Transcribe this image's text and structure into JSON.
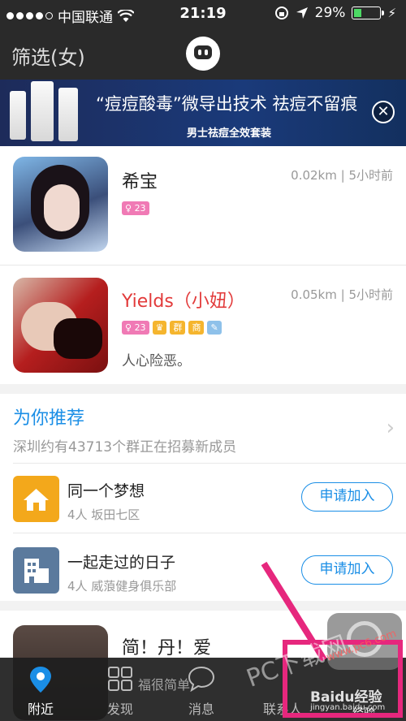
{
  "status_bar": {
    "carrier": "中国联通",
    "time": "21:19",
    "battery": "29%"
  },
  "nav": {
    "title": "筛选(女)"
  },
  "ad": {
    "headline": "“痘痘酸毒”微导出技术 祛痘不留痕",
    "sub": "男士祛痘全效套装"
  },
  "users": [
    {
      "name": "希宝",
      "distance": "0.02km",
      "time": "5小时前",
      "age": "23",
      "bio": ""
    },
    {
      "name": "Yields（小妞）",
      "distance": "0.05km",
      "time": "5小时前",
      "age": "23",
      "bio": "人心险恶。"
    },
    {
      "name": "简！丹！爱",
      "distance": "",
      "time": "",
      "age": "",
      "bio": "福很简单"
    }
  ],
  "badges": {
    "crown": "♛",
    "group": "群",
    "biz": "商"
  },
  "recommend": {
    "title": "为你推荐",
    "subtitle": "深圳约有43713个群正在招募新成员"
  },
  "groups": [
    {
      "name": "同一个梦想",
      "meta": "4人 坂田七区",
      "button": "申请加入"
    },
    {
      "name": "一起走过的日子",
      "meta": "4人 威蒗健身俱乐部",
      "button": "申请加入"
    }
  ],
  "tabs": [
    {
      "label": "附近"
    },
    {
      "label": "发现"
    },
    {
      "label": "消息"
    },
    {
      "label": "联系人"
    },
    {
      "label": "经验"
    }
  ],
  "watermark": {
    "text1": "PC下载网",
    "text2": "www.pc6.com",
    "text3": "Baidu经验",
    "text4": "jingyan.baidu.com"
  }
}
